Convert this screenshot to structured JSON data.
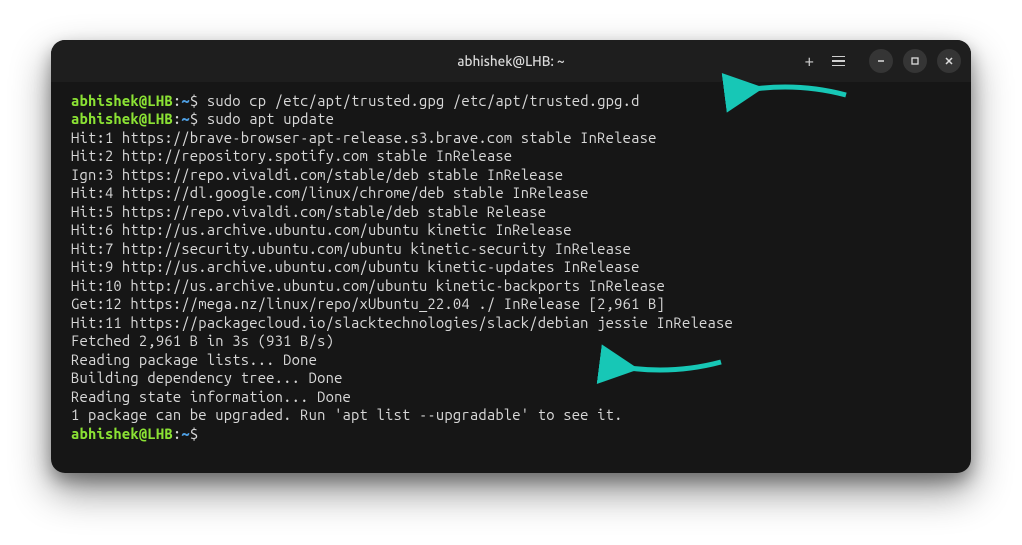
{
  "window": {
    "title": "abhishek@LHB: ~"
  },
  "prompt": {
    "user_host": "abhishek@LHB",
    "separator1": ":",
    "path": "~",
    "separator2": "$ "
  },
  "commands": {
    "cmd1": "sudo cp /etc/apt/trusted.gpg /etc/apt/trusted.gpg.d",
    "cmd2": "sudo apt update"
  },
  "output_lines": [
    "Hit:1 https://brave-browser-apt-release.s3.brave.com stable InRelease",
    "Hit:2 http://repository.spotify.com stable InRelease",
    "Ign:3 https://repo.vivaldi.com/stable/deb stable InRelease",
    "Hit:4 https://dl.google.com/linux/chrome/deb stable InRelease",
    "Hit:5 https://repo.vivaldi.com/stable/deb stable Release",
    "Hit:6 http://us.archive.ubuntu.com/ubuntu kinetic InRelease",
    "Hit:7 http://security.ubuntu.com/ubuntu kinetic-security InRelease",
    "Hit:9 http://us.archive.ubuntu.com/ubuntu kinetic-updates InRelease",
    "Hit:10 http://us.archive.ubuntu.com/ubuntu kinetic-backports InRelease",
    "Get:12 https://mega.nz/linux/repo/xUbuntu_22.04 ./ InRelease [2,961 B]",
    "Hit:11 https://packagecloud.io/slacktechnologies/slack/debian jessie InRelease",
    "Fetched 2,961 B in 3s (931 B/s)",
    "Reading package lists... Done",
    "Building dependency tree... Done",
    "Reading state information... Done",
    "1 package can be upgraded. Run 'apt list --upgradable' to see it."
  ]
}
